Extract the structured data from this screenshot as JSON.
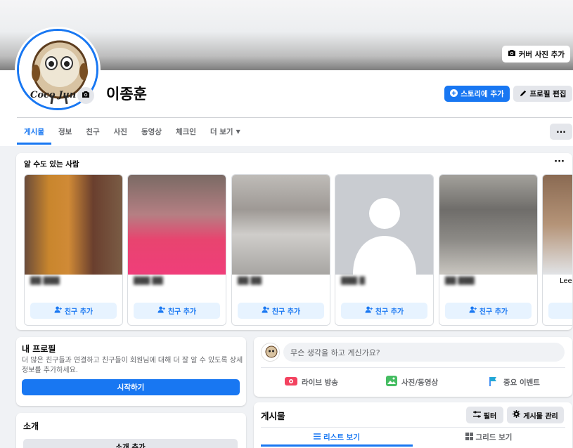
{
  "profile": {
    "name": "이종훈",
    "cover_button": "커버 사진 추가",
    "avatar_text": "Coco Jun",
    "add_story": "스토리에 추가",
    "edit_profile": "프로필 편집"
  },
  "tabs": [
    "게시물",
    "정보",
    "친구",
    "사진",
    "동영상",
    "체크인",
    "더 보기"
  ],
  "more_label": "···",
  "pymk": {
    "title": "알 수도 있는 사람",
    "menu": "···",
    "add_friend": "친구 추가",
    "cards": [
      {
        "name": "██ ███"
      },
      {
        "name": "███ ██"
      },
      {
        "name": "██ ██"
      },
      {
        "name": "███ █"
      },
      {
        "name": "██ ███"
      },
      {
        "name": "Lee"
      }
    ]
  },
  "intro": {
    "title": "내 프로필",
    "desc": "더 많은 친구들과 연결하고 친구들이 회원님에 대해 더 잘 알 수 있도록 상세 정보를 추가하세요.",
    "start": "시작하기"
  },
  "about": {
    "title": "소개",
    "add": "소개 추가"
  },
  "composer": {
    "placeholder": "무슨 생각을 하고 계신가요?",
    "live": "라이브 방송",
    "photo": "사진/동영상",
    "event": "중요 이벤트"
  },
  "posts": {
    "title": "게시물",
    "filter": "필터",
    "manage": "게시물 관리",
    "list_view": "리스트 보기",
    "grid_view": "그리드 보기"
  },
  "colors": {
    "accent": "#1877f2",
    "live_red": "#f3425f",
    "photo_green": "#45bd62",
    "event_blue": "#1877f2"
  }
}
